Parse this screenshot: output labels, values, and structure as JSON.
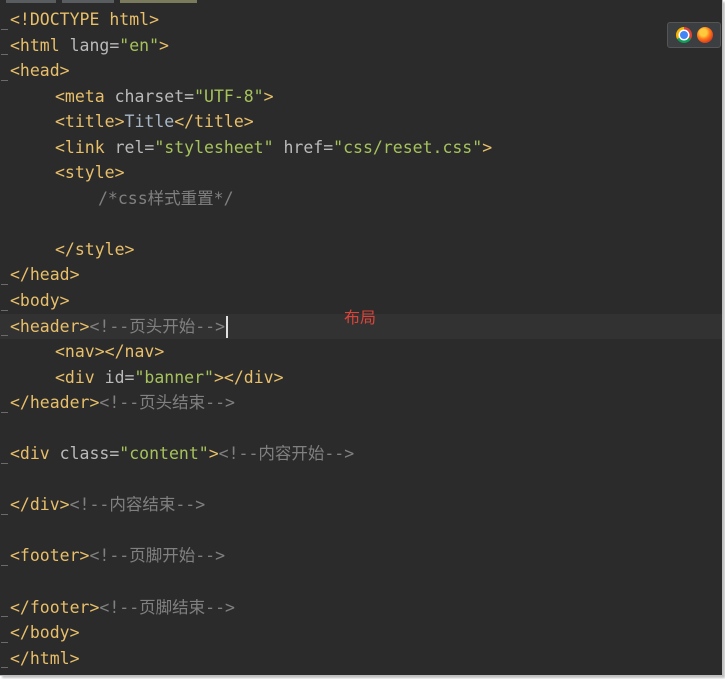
{
  "editor": {
    "lines": [
      {
        "indent": 0,
        "tokens": [
          [
            "doc",
            "<!DOCTYPE html>"
          ]
        ]
      },
      {
        "indent": 0,
        "tokens": [
          [
            "tag",
            "<html"
          ],
          [
            "attr",
            " lang="
          ],
          [
            "str",
            "\"en\""
          ],
          [
            "tag",
            ">"
          ]
        ]
      },
      {
        "indent": 0,
        "tokens": [
          [
            "tag",
            "<head>"
          ]
        ]
      },
      {
        "indent": 1,
        "tokens": [
          [
            "tag",
            "<meta"
          ],
          [
            "attr",
            " charset="
          ],
          [
            "str",
            "\"UTF-8\""
          ],
          [
            "tag",
            ">"
          ]
        ]
      },
      {
        "indent": 1,
        "tokens": [
          [
            "tag",
            "<title>"
          ],
          [
            "txt",
            "Title"
          ],
          [
            "tag",
            "</title>"
          ]
        ]
      },
      {
        "indent": 1,
        "tokens": [
          [
            "tag",
            "<link"
          ],
          [
            "attr",
            " rel="
          ],
          [
            "str",
            "\"stylesheet\""
          ],
          [
            "attr",
            " href="
          ],
          [
            "str",
            "\"css/reset.css\""
          ],
          [
            "tag",
            ">"
          ]
        ]
      },
      {
        "indent": 1,
        "tokens": [
          [
            "tag",
            "<style>"
          ]
        ]
      },
      {
        "indent": 2,
        "tokens": [
          [
            "cmt",
            "/*css样式重置*/"
          ]
        ]
      },
      {
        "indent": 0,
        "tokens": []
      },
      {
        "indent": 1,
        "tokens": [
          [
            "tag",
            "</style>"
          ]
        ]
      },
      {
        "indent": 0,
        "tokens": [
          [
            "tag",
            "</head>"
          ]
        ]
      },
      {
        "indent": 0,
        "tokens": [
          [
            "tag",
            "<body>"
          ]
        ]
      },
      {
        "indent": 0,
        "tokens": [
          [
            "tag",
            "<header>"
          ],
          [
            "cmt",
            "<!--页头开始-->"
          ]
        ],
        "caret": true
      },
      {
        "indent": 1,
        "tokens": [
          [
            "tag",
            "<nav></nav>"
          ]
        ]
      },
      {
        "indent": 1,
        "tokens": [
          [
            "tag",
            "<div"
          ],
          [
            "attr",
            " id="
          ],
          [
            "str",
            "\"banner\""
          ],
          [
            "tag",
            "></div>"
          ]
        ]
      },
      {
        "indent": 0,
        "tokens": [
          [
            "tag",
            "</header>"
          ],
          [
            "cmt",
            "<!--页头结束-->"
          ]
        ]
      },
      {
        "indent": 0,
        "tokens": []
      },
      {
        "indent": 0,
        "tokens": [
          [
            "tag",
            "<div"
          ],
          [
            "attr",
            " class="
          ],
          [
            "str",
            "\"content\""
          ],
          [
            "tag",
            ">"
          ],
          [
            "cmt",
            "<!--内容开始-->"
          ]
        ]
      },
      {
        "indent": 0,
        "tokens": []
      },
      {
        "indent": 0,
        "tokens": [
          [
            "tag",
            "</div>"
          ],
          [
            "cmt",
            "<!--内容结束-->"
          ]
        ]
      },
      {
        "indent": 0,
        "tokens": []
      },
      {
        "indent": 0,
        "tokens": [
          [
            "tag",
            "<footer>"
          ],
          [
            "cmt",
            "<!--页脚开始-->"
          ]
        ]
      },
      {
        "indent": 0,
        "tokens": []
      },
      {
        "indent": 0,
        "tokens": [
          [
            "tag",
            "</footer>"
          ],
          [
            "cmt",
            "<!--页脚结束-->"
          ]
        ]
      },
      {
        "indent": 0,
        "tokens": [
          [
            "tag",
            "</body>"
          ]
        ]
      },
      {
        "indent": 0,
        "tokens": [
          [
            "tag",
            "</html>"
          ]
        ]
      }
    ]
  },
  "annotation": {
    "text": "布局",
    "color": "#d9453a"
  },
  "browser_bar": {
    "icons": [
      "chrome-icon",
      "firefox-icon"
    ]
  },
  "colors": {
    "background": "#2b2b2b",
    "tag": "#e8bf6a",
    "attribute": "#bababa",
    "string": "#a5c25c",
    "comment": "#808080"
  }
}
